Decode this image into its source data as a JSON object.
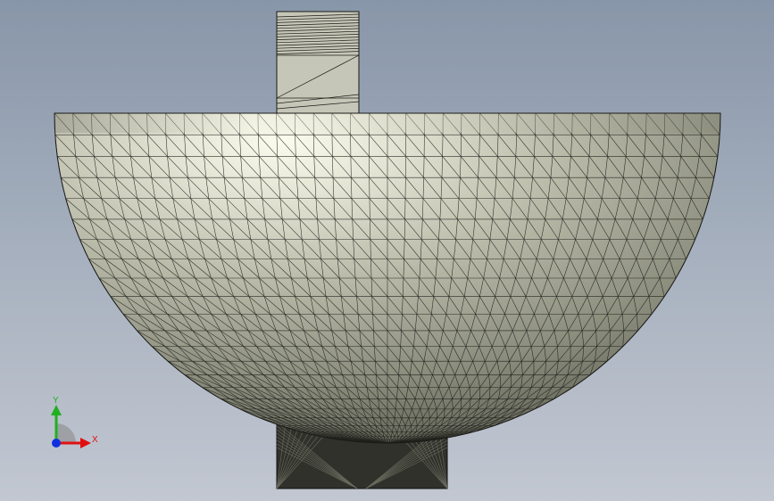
{
  "viewport": {
    "background_top": "#8896a9",
    "background_bottom": "#c2c7d1"
  },
  "model": {
    "body_color": "#c9cab8",
    "highlight_color": "#fbfcee",
    "shadow_color": "#5e6054",
    "base_color": "#30312b",
    "shaft_color": "#c6c6b8",
    "mesh_color": "#1a1a16"
  },
  "triad": {
    "x_label": "X",
    "y_label": "Y",
    "x_color": "#e01010",
    "y_color": "#20b020",
    "z_color": "#1030e0"
  }
}
